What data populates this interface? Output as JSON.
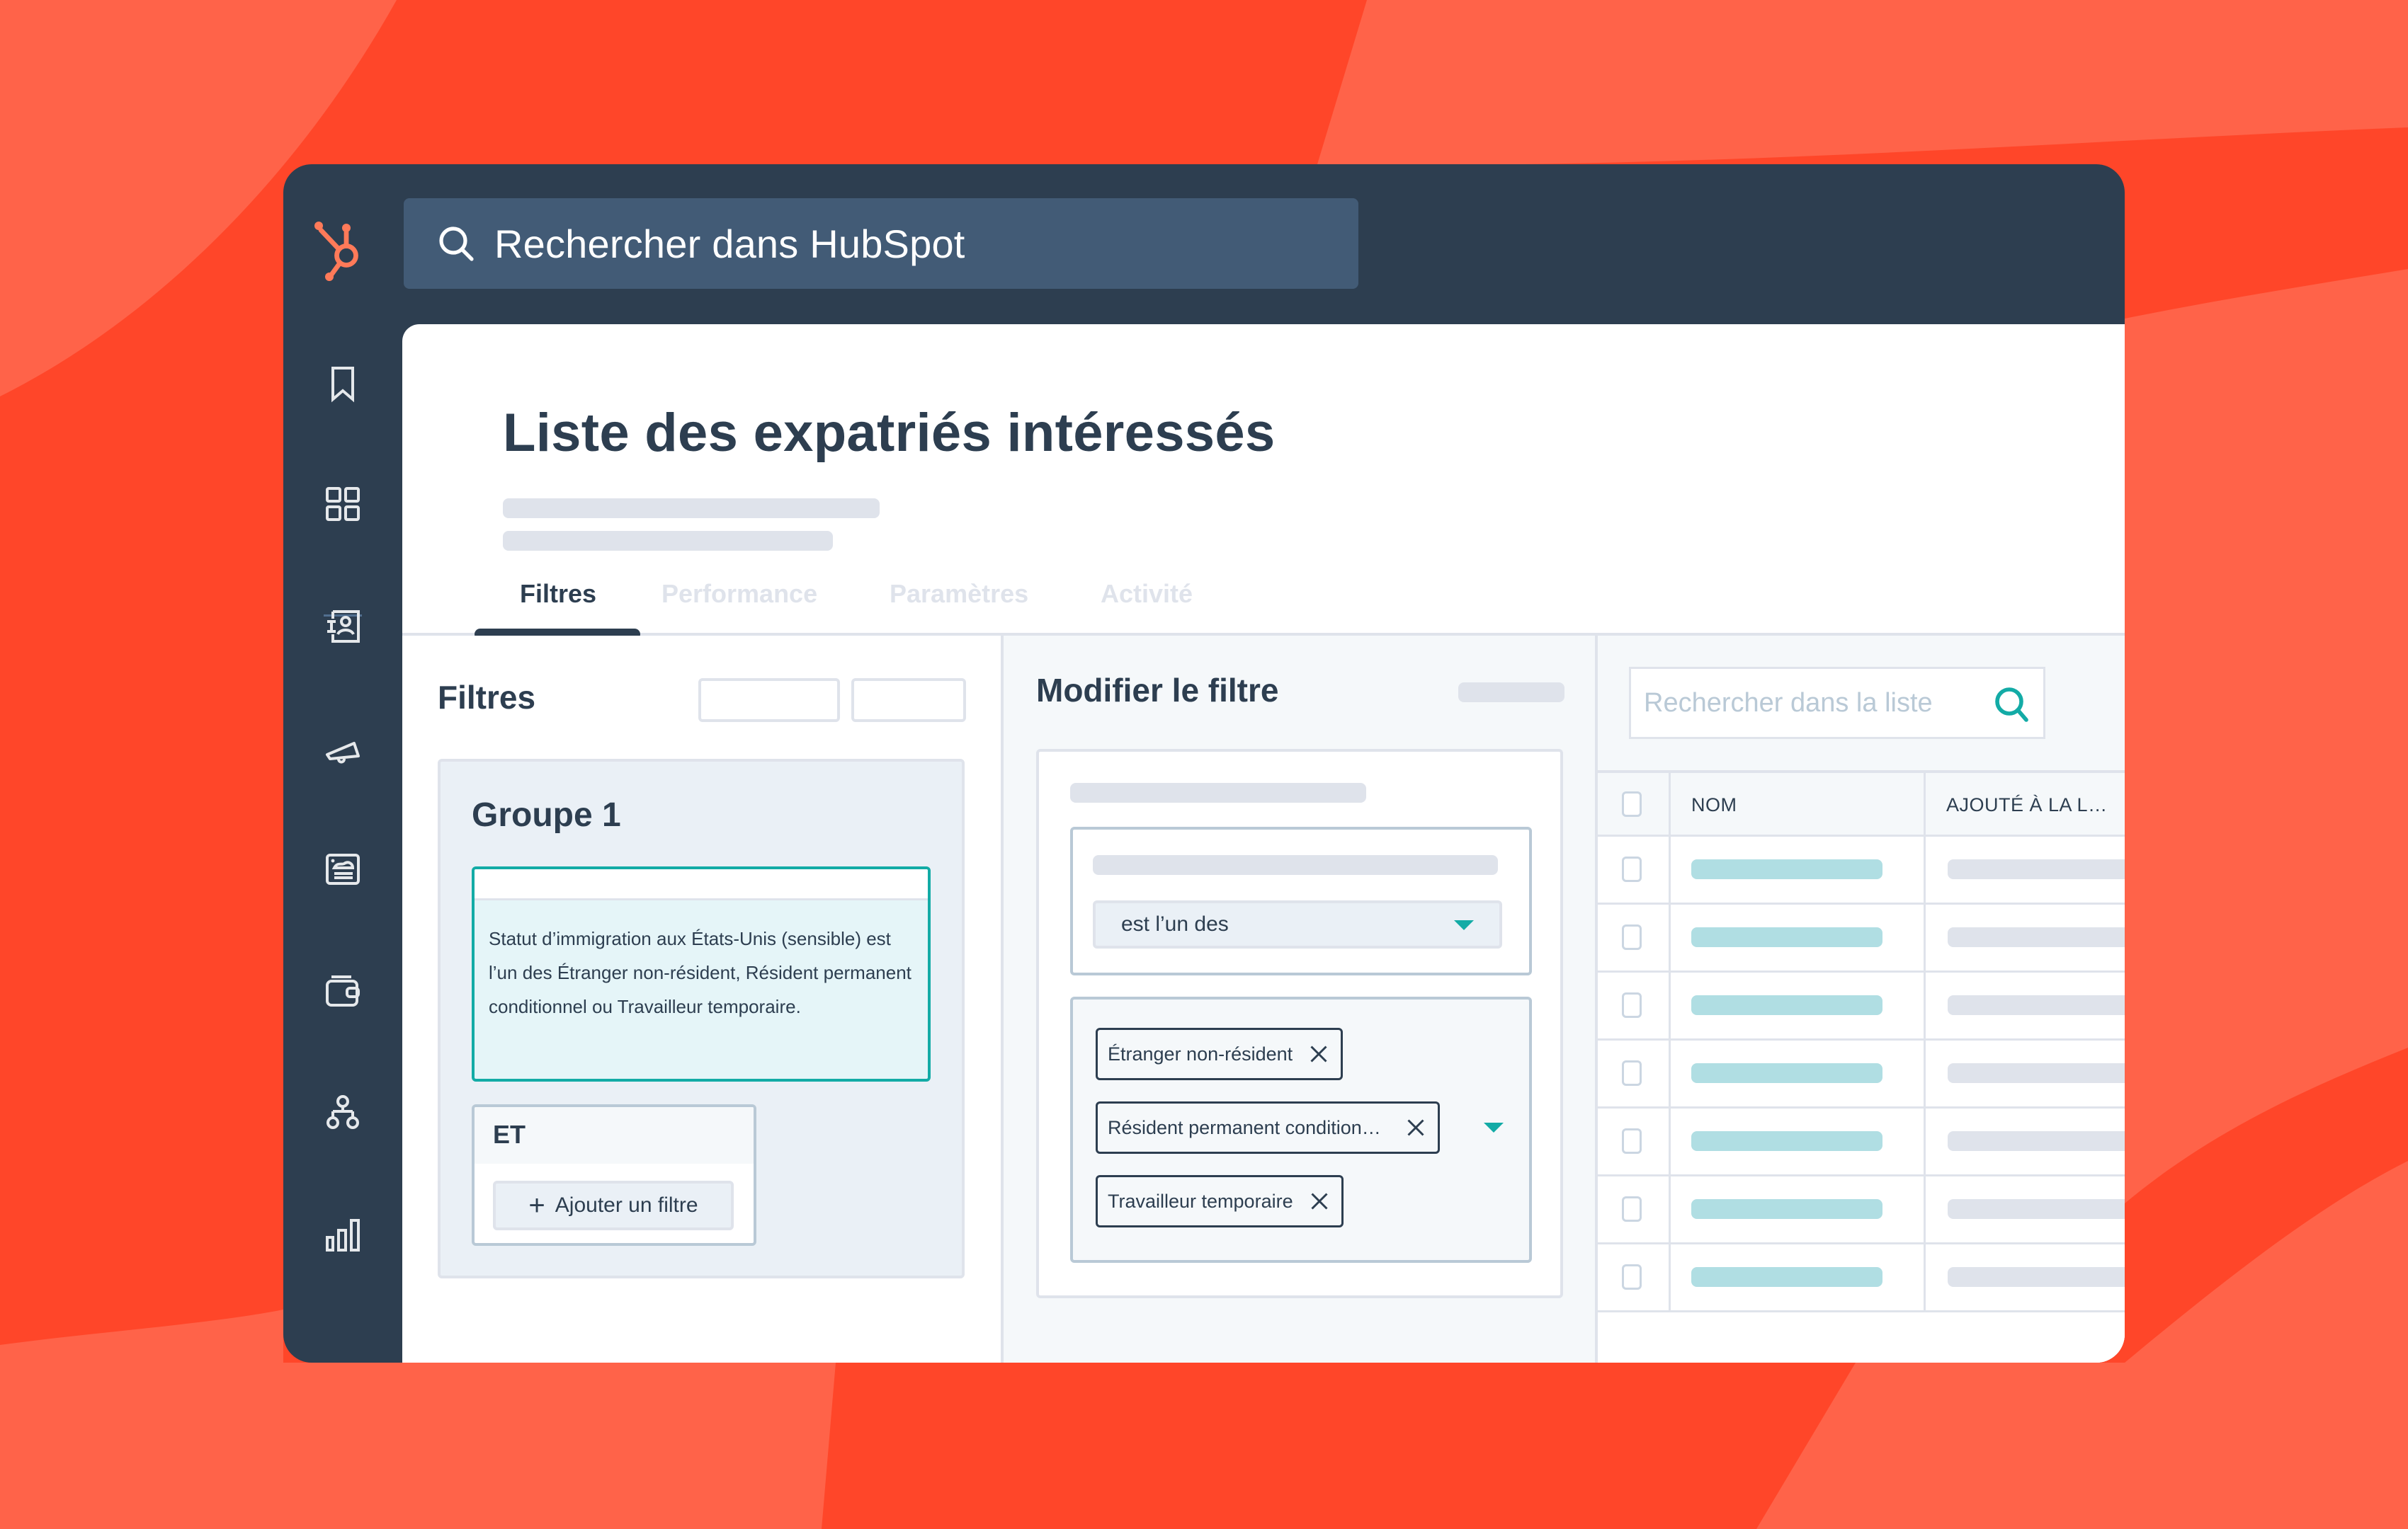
{
  "app": {
    "brand": "HubSpot",
    "accent_color": "#ff7a59",
    "teal_color": "#13aba6",
    "global_search": {
      "placeholder": "Rechercher dans HubSpot"
    }
  },
  "sidebar": {
    "items": [
      {
        "icon": "bookmark-icon"
      },
      {
        "icon": "dashboard-grid-icon"
      },
      {
        "icon": "contacts-icon"
      },
      {
        "icon": "marketing-megaphone-icon"
      },
      {
        "icon": "content-icon"
      },
      {
        "icon": "commerce-wallet-icon"
      },
      {
        "icon": "automation-icon"
      },
      {
        "icon": "reporting-icon"
      }
    ]
  },
  "page": {
    "title": "Liste des expatriés intéressés",
    "tabs": [
      {
        "label": "Filtres",
        "active": true
      },
      {
        "label": "Performance",
        "active": false
      },
      {
        "label": "Paramètres",
        "active": false
      },
      {
        "label": "Activité",
        "active": false
      }
    ]
  },
  "filters_panel": {
    "title": "Filtres",
    "group": {
      "title": "Groupe 1",
      "filter_description": "Statut d’immigration aux États-Unis (sensible) est l’un des Étranger non-résident, Résident permanent conditionnel ou Travailleur temporaire.",
      "and_label": "ET",
      "add_filter_label": "Ajouter un filtre"
    }
  },
  "edit_panel": {
    "title": "Modifier le filtre",
    "operator": "est l’un des",
    "selected_values": [
      "Étranger non-résident",
      "Résident permanent condition…",
      "Travailleur temporaire"
    ]
  },
  "table_panel": {
    "search_placeholder": "Rechercher dans la liste",
    "columns": [
      "NOM",
      "AJOUTÉ À LA L…"
    ],
    "row_count": 7
  }
}
